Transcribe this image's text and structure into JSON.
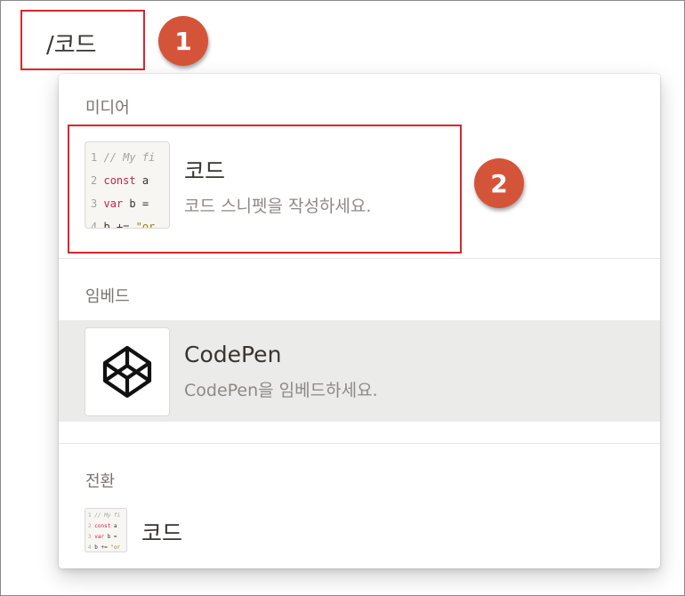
{
  "command": {
    "text": "/코드"
  },
  "callouts": [
    "1",
    "2"
  ],
  "colors": {
    "callout": "#d4543a",
    "annotation_box": "#d9262e",
    "hover": "#ebebea"
  },
  "sections": [
    {
      "label": "미디어",
      "item": {
        "title": "코드",
        "description": "코드 스니펫을 작성하세요.",
        "thumbnail": {
          "line_numbers": [
            "1",
            "2",
            "3",
            "4"
          ],
          "comment": "// My fi",
          "line2_keyword": "const",
          "line2_rest": " a",
          "line3_keyword": "var",
          "line3_rest": " b =",
          "line4_code": "b +=",
          "line4_string": "\"or"
        }
      }
    },
    {
      "label": "임베드",
      "item": {
        "title": "CodePen",
        "description": "CodePen을 임베드하세요.",
        "icon": "codepen-icon"
      }
    },
    {
      "label": "전환",
      "item": {
        "title": "코드",
        "icon": "code-thumbnail-icon"
      }
    }
  ]
}
